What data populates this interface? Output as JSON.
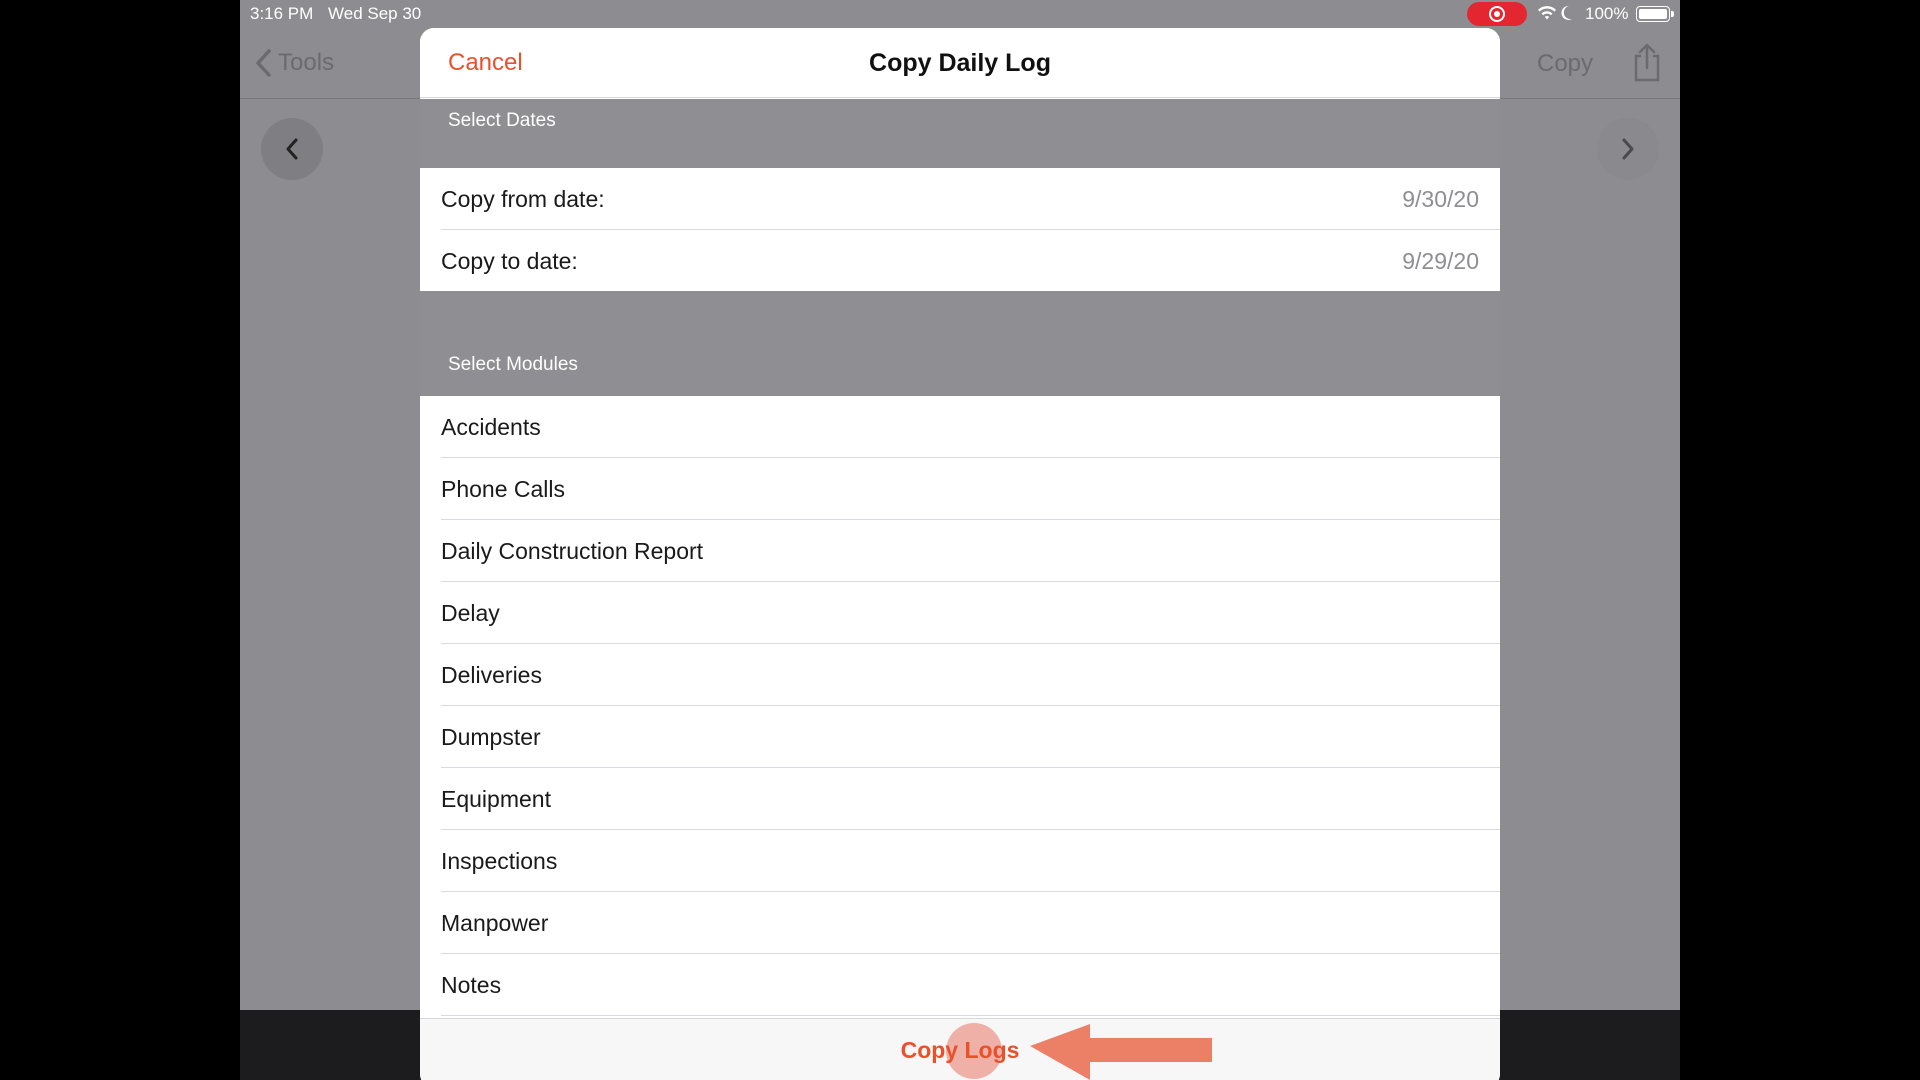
{
  "status_bar": {
    "time": "3:16 PM",
    "date": "Wed Sep 30",
    "battery_percent": "100%",
    "recording_color": "#e3262f"
  },
  "background": {
    "back_label": "Tools",
    "copy_label": "Copy"
  },
  "modal": {
    "cancel_label": "Cancel",
    "title": "Copy Daily Log",
    "dates_section": "Select Dates",
    "copy_from_label": "Copy from date:",
    "copy_from_value": "9/30/20",
    "copy_to_label": "Copy to date:",
    "copy_to_value": "9/29/20",
    "modules_section": "Select Modules",
    "modules": [
      "Accidents",
      "Phone Calls",
      "Daily Construction Report",
      "Delay",
      "Deliveries",
      "Dumpster",
      "Equipment",
      "Inspections",
      "Manpower",
      "Notes"
    ],
    "copy_logs_label": "Copy Logs",
    "accent_color": "#e8512a"
  }
}
